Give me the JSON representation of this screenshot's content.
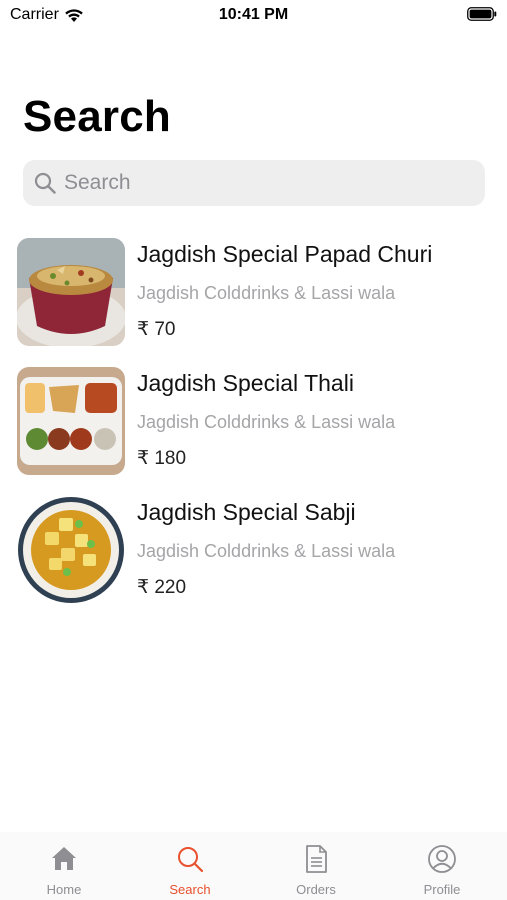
{
  "status_bar": {
    "carrier": "Carrier",
    "time": "10:41 PM"
  },
  "page": {
    "title": "Search"
  },
  "search": {
    "placeholder": "Search",
    "value": ""
  },
  "results": [
    {
      "title": "Jagdish Special Papad Churi",
      "restaurant": "Jagdish Colddrinks & Lassi wala",
      "price": "₹ 70"
    },
    {
      "title": "Jagdish Special Thali",
      "restaurant": "Jagdish Colddrinks & Lassi wala",
      "price": "₹ 180"
    },
    {
      "title": "Jagdish Special Sabji",
      "restaurant": "Jagdish Colddrinks & Lassi wala",
      "price": "₹ 220"
    }
  ],
  "tab_bar": {
    "tabs": [
      {
        "label": "Home",
        "icon": "home-icon",
        "active": false
      },
      {
        "label": "Search",
        "icon": "search-icon",
        "active": true
      },
      {
        "label": "Orders",
        "icon": "document-icon",
        "active": false
      },
      {
        "label": "Profile",
        "icon": "user-circle-icon",
        "active": false
      }
    ]
  },
  "colors": {
    "accent": "#e8502e",
    "inactive": "#8e8e93",
    "search_bg": "#eeeeef",
    "subtitle": "#a5a5a8"
  }
}
